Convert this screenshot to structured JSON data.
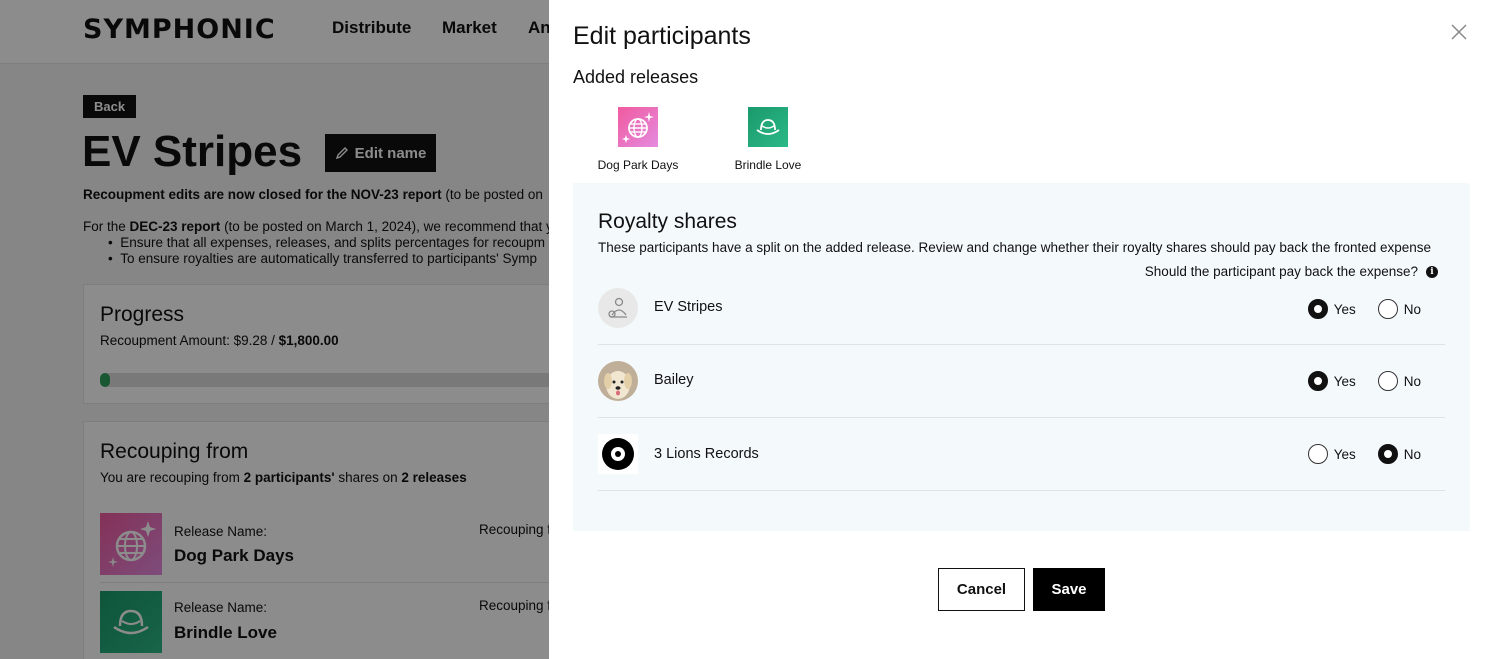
{
  "background": {
    "logo": "SYMPHONIC",
    "nav": [
      "Distribute",
      "Market",
      "An"
    ],
    "back_label": "Back",
    "title": "EV Stripes",
    "edit_name_label": "Edit name",
    "notice_bold": "Recoupment edits are now closed for the NOV-23 report",
    "notice_rest": " (to be posted on",
    "notice2_prefix": "For the ",
    "notice2_bold": "DEC-23 report",
    "notice2_rest": " (to be posted on March 1, 2024), we recommend that y",
    "bullets": [
      "Ensure that all expenses, releases, and splits percentages for recoupm",
      "To ensure royalties are automatically transferred to participants' Symp"
    ],
    "progress": {
      "title": "Progress",
      "amount_prefix": "Recoupment Amount: $9.28 / ",
      "amount_total": "$1,800.00",
      "fraction": 0.005
    },
    "recouping": {
      "title": "Recouping from",
      "sub_prefix": "You are recouping from ",
      "sub_bold1": "2 participants'",
      "sub_mid": " shares on ",
      "sub_bold2": "2 releases",
      "releases": [
        {
          "label": "Release Name:",
          "name": "Dog Park Days",
          "recouping_label": "Recouping f"
        },
        {
          "label": "Release Name:",
          "name": "Brindle Love",
          "recouping_label": "Recouping f"
        }
      ]
    }
  },
  "drawer": {
    "title": "Edit participants",
    "added_releases_label": "Added releases",
    "releases": [
      {
        "name": "Dog Park Days",
        "color": "#e86bb8"
      },
      {
        "name": "Brindle Love",
        "color": "#1fa57a"
      }
    ],
    "royalty": {
      "title": "Royalty shares",
      "description": "These participants have a split on the added release. Review and change whether their royalty shares should pay back the fronted expense",
      "question": "Should the participant pay back the expense?",
      "yes_label": "Yes",
      "no_label": "No",
      "participants": [
        {
          "name": "EV Stripes",
          "selected": "yes"
        },
        {
          "name": "Bailey",
          "selected": "yes"
        },
        {
          "name": "3 Lions Records",
          "selected": "no"
        }
      ]
    },
    "cancel_label": "Cancel",
    "save_label": "Save"
  }
}
